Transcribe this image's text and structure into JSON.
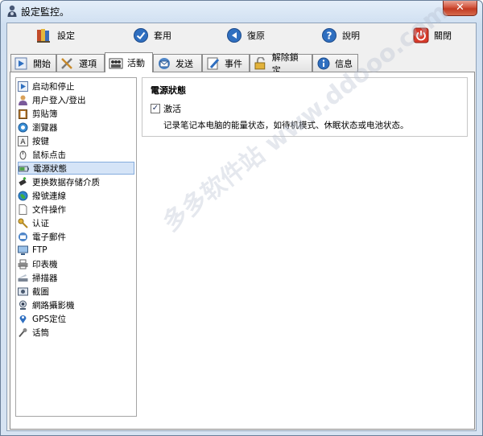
{
  "window": {
    "title": "設定監控。",
    "close_glyph": "✕"
  },
  "toolbar": {
    "items": [
      {
        "label": "設定",
        "icon": "settings-books-icon"
      },
      {
        "label": "套用",
        "icon": "apply-check-icon"
      },
      {
        "label": "復原",
        "icon": "restore-arrow-icon"
      },
      {
        "label": "說明",
        "icon": "help-question-icon"
      },
      {
        "label": "關閉",
        "icon": "power-close-icon"
      }
    ]
  },
  "tabs": [
    {
      "label": "開始",
      "icon": "start-play-icon"
    },
    {
      "label": "選項",
      "icon": "options-tools-icon"
    },
    {
      "label": "活動",
      "icon": "activity-people-icon"
    },
    {
      "label": "发送",
      "icon": "send-envelope-icon"
    },
    {
      "label": "事件",
      "icon": "event-pencil-icon"
    },
    {
      "label": "解除鎖定",
      "icon": "unlock-padlock-icon"
    },
    {
      "label": "信息",
      "icon": "info-icon"
    }
  ],
  "tree": {
    "items": [
      {
        "label": "启动和停止",
        "icon": "play-icon"
      },
      {
        "label": "用户登入/登出",
        "icon": "user-icon"
      },
      {
        "label": "剪貼簿",
        "icon": "clipboard-icon"
      },
      {
        "label": "瀏覽器",
        "icon": "browser-icon"
      },
      {
        "label": "按键",
        "icon": "key-a-icon"
      },
      {
        "label": "鼠标点击",
        "icon": "mouse-icon"
      },
      {
        "label": "電源狀態",
        "icon": "battery-icon"
      },
      {
        "label": "更换数据存储介质",
        "icon": "usb-drive-icon"
      },
      {
        "label": "撥號連線",
        "icon": "globe-icon"
      },
      {
        "label": "文件操作",
        "icon": "file-icon"
      },
      {
        "label": "认证",
        "icon": "key-icon"
      },
      {
        "label": "電子郵件",
        "icon": "email-icon"
      },
      {
        "label": "FTP",
        "icon": "ftp-icon"
      },
      {
        "label": "印表機",
        "icon": "printer-icon"
      },
      {
        "label": "掃描器",
        "icon": "scanner-icon"
      },
      {
        "label": "截圖",
        "icon": "screenshot-icon"
      },
      {
        "label": "網路攝影機",
        "icon": "webcam-icon"
      },
      {
        "label": "GPS定位",
        "icon": "gps-pin-icon"
      },
      {
        "label": "话筒",
        "icon": "microphone-icon"
      }
    ],
    "selected_index": 6
  },
  "content": {
    "section_title": "電源狀態",
    "checkbox_label": "激活",
    "checkbox_checked": true,
    "checkbox_glyph": "✓",
    "description": "记录笔记本电脑的能量状态，如待机模式、休眠状态或电池状态。"
  },
  "watermark": "多多软件站 www.ddooo.com"
}
